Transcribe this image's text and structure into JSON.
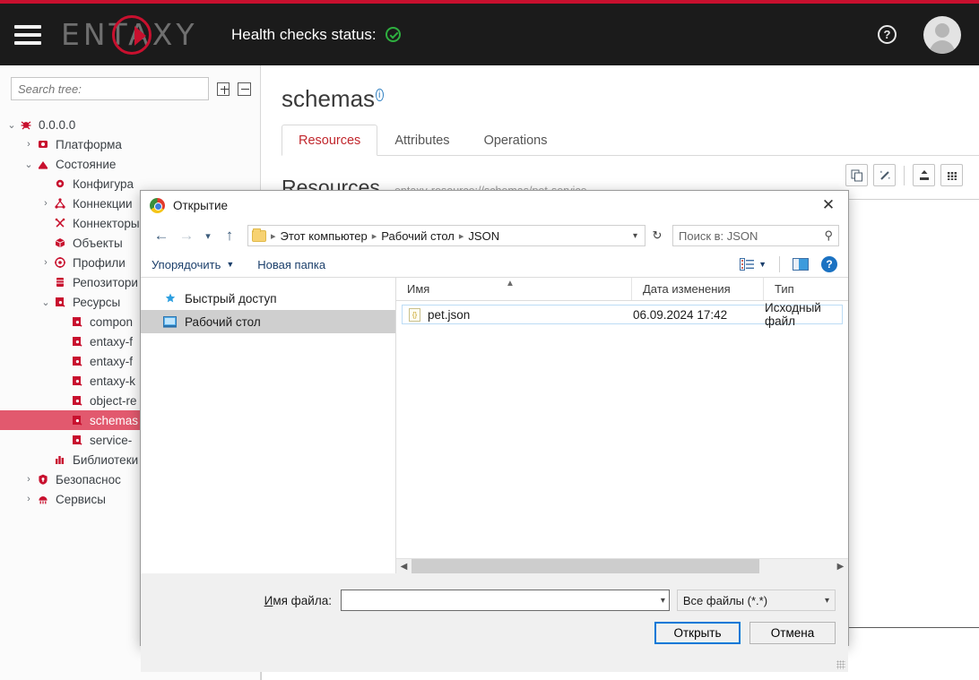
{
  "header": {
    "menu_icon": "hamburger-icon",
    "logo_text": "ENTAXY",
    "health_label": "Health checks status:",
    "health_status": "ok",
    "help_icon": "question-mark-icon",
    "avatar_icon": "user-avatar-icon"
  },
  "sidebar": {
    "search_placeholder": "Search tree:",
    "expand_all_icon": "expand-all-icon",
    "collapse_all_icon": "collapse-all-icon",
    "tree": [
      {
        "label": "0.0.0.0",
        "depth": 0,
        "caret": "down",
        "icon": "server-icon",
        "selected": false
      },
      {
        "label": "Платформа",
        "depth": 1,
        "caret": "right",
        "icon": "platform-icon",
        "selected": false
      },
      {
        "label": "Состояние",
        "depth": 1,
        "caret": "down",
        "icon": "state-icon",
        "selected": false
      },
      {
        "label": "Конфигура",
        "depth": 2,
        "caret": "none",
        "icon": "config-icon",
        "selected": false
      },
      {
        "label": "Коннекции",
        "depth": 2,
        "caret": "right",
        "icon": "connections-icon",
        "selected": false
      },
      {
        "label": "Коннекторы",
        "depth": 2,
        "caret": "none",
        "icon": "connectors-icon",
        "selected": false
      },
      {
        "label": "Объекты",
        "depth": 2,
        "caret": "none",
        "icon": "objects-icon",
        "selected": false
      },
      {
        "label": "Профили",
        "depth": 2,
        "caret": "right",
        "icon": "profiles-icon",
        "selected": false
      },
      {
        "label": "Репозитори",
        "depth": 2,
        "caret": "none",
        "icon": "repository-icon",
        "selected": false
      },
      {
        "label": "Ресурсы",
        "depth": 2,
        "caret": "down",
        "icon": "resources-icon",
        "selected": false
      },
      {
        "label": "compon",
        "depth": 3,
        "caret": "none",
        "icon": "resource-icon",
        "selected": false
      },
      {
        "label": "entaxy-f",
        "depth": 3,
        "caret": "none",
        "icon": "resource-icon",
        "selected": false
      },
      {
        "label": "entaxy-f",
        "depth": 3,
        "caret": "none",
        "icon": "resource-icon",
        "selected": false
      },
      {
        "label": "entaxy-k",
        "depth": 3,
        "caret": "none",
        "icon": "resource-icon",
        "selected": false
      },
      {
        "label": "object-re",
        "depth": 3,
        "caret": "none",
        "icon": "resource-icon",
        "selected": false
      },
      {
        "label": "schemas",
        "depth": 3,
        "caret": "none",
        "icon": "resource-icon",
        "selected": true
      },
      {
        "label": "service-",
        "depth": 3,
        "caret": "none",
        "icon": "resource-icon",
        "selected": false
      },
      {
        "label": "Библиотеки",
        "depth": 2,
        "caret": "none",
        "icon": "libraries-icon",
        "selected": false
      },
      {
        "label": "Безопаснос",
        "depth": 1,
        "caret": "right",
        "icon": "security-icon",
        "selected": false
      },
      {
        "label": "Сервисы",
        "depth": 1,
        "caret": "right",
        "icon": "services-icon",
        "selected": false
      }
    ]
  },
  "main": {
    "page_title": "schemas",
    "info_badge": "i",
    "tabs": [
      {
        "label": "Resources",
        "active": true
      },
      {
        "label": "Attributes",
        "active": false
      },
      {
        "label": "Operations",
        "active": false
      }
    ],
    "resources_title": "Resources",
    "resources_uri": "entaxy-resource://schemas/pet-service",
    "tools": [
      {
        "name": "copy-button",
        "icon": "copy-icon"
      },
      {
        "name": "wand-button",
        "icon": "magic-wand-icon"
      },
      {
        "name": "upload-button",
        "icon": "upload-icon"
      },
      {
        "name": "grid-button",
        "icon": "grid-icon"
      }
    ]
  },
  "dialog": {
    "title": "Открытие",
    "title_icon": "chrome-icon",
    "close_icon": "close-icon",
    "nav": {
      "back_icon": "arrow-left-icon",
      "forward_icon": "arrow-right-icon",
      "recent_icon": "chevron-down-icon",
      "up_icon": "arrow-up-icon",
      "folder_icon": "folder-icon",
      "breadcrumbs": [
        "Этот компьютер",
        "Рабочий стол",
        "JSON"
      ],
      "crumb_dropdown_icon": "chevron-down-icon",
      "refresh_icon": "refresh-icon",
      "search_placeholder": "Поиск в: JSON",
      "search_value": "",
      "search_icon": "magnifier-icon"
    },
    "toolbar": {
      "organize_label": "Упорядочить",
      "new_folder_label": "Новая папка",
      "view_icon": "list-view-icon",
      "view_caret_icon": "chevron-down-icon",
      "preview_pane_icon": "preview-pane-icon",
      "help_icon": "help-circle-icon"
    },
    "places": [
      {
        "label": "Быстрый доступ",
        "icon": "pin-star-icon",
        "selected": false
      },
      {
        "label": "Рабочий стол",
        "icon": "desktop-icon",
        "selected": true
      }
    ],
    "columns": [
      "Имя",
      "Дата изменения",
      "Тип"
    ],
    "sort_indicator_icon": "sort-asc-icon",
    "files": [
      {
        "name": "pet.json",
        "modified": "06.09.2024 17:42",
        "type": "Исходный файл",
        "icon": "json-file-icon",
        "selected": true
      }
    ],
    "hscroll": {
      "left_arrow_icon": "chevron-left-icon",
      "right_arrow_icon": "chevron-right-icon"
    },
    "footer": {
      "filename_label": "Имя файла:",
      "filename_label_accel": "И",
      "filename_label_rest": "мя файла:",
      "filename_value": "",
      "filename_caret_icon": "chevron-down-icon",
      "filter_value": "Все файлы (*.*)",
      "filter_caret_icon": "chevron-down-icon",
      "open_button": "Открыть",
      "cancel_button": "Отмена",
      "resize_grip_icon": "resize-grip-icon"
    }
  },
  "colors": {
    "brand_red": "#c8102e",
    "accent_pink": "#e2596e",
    "tab_active": "#c1272d",
    "health_green": "#2eaf3f",
    "dialog_blue": "#0078d7"
  }
}
